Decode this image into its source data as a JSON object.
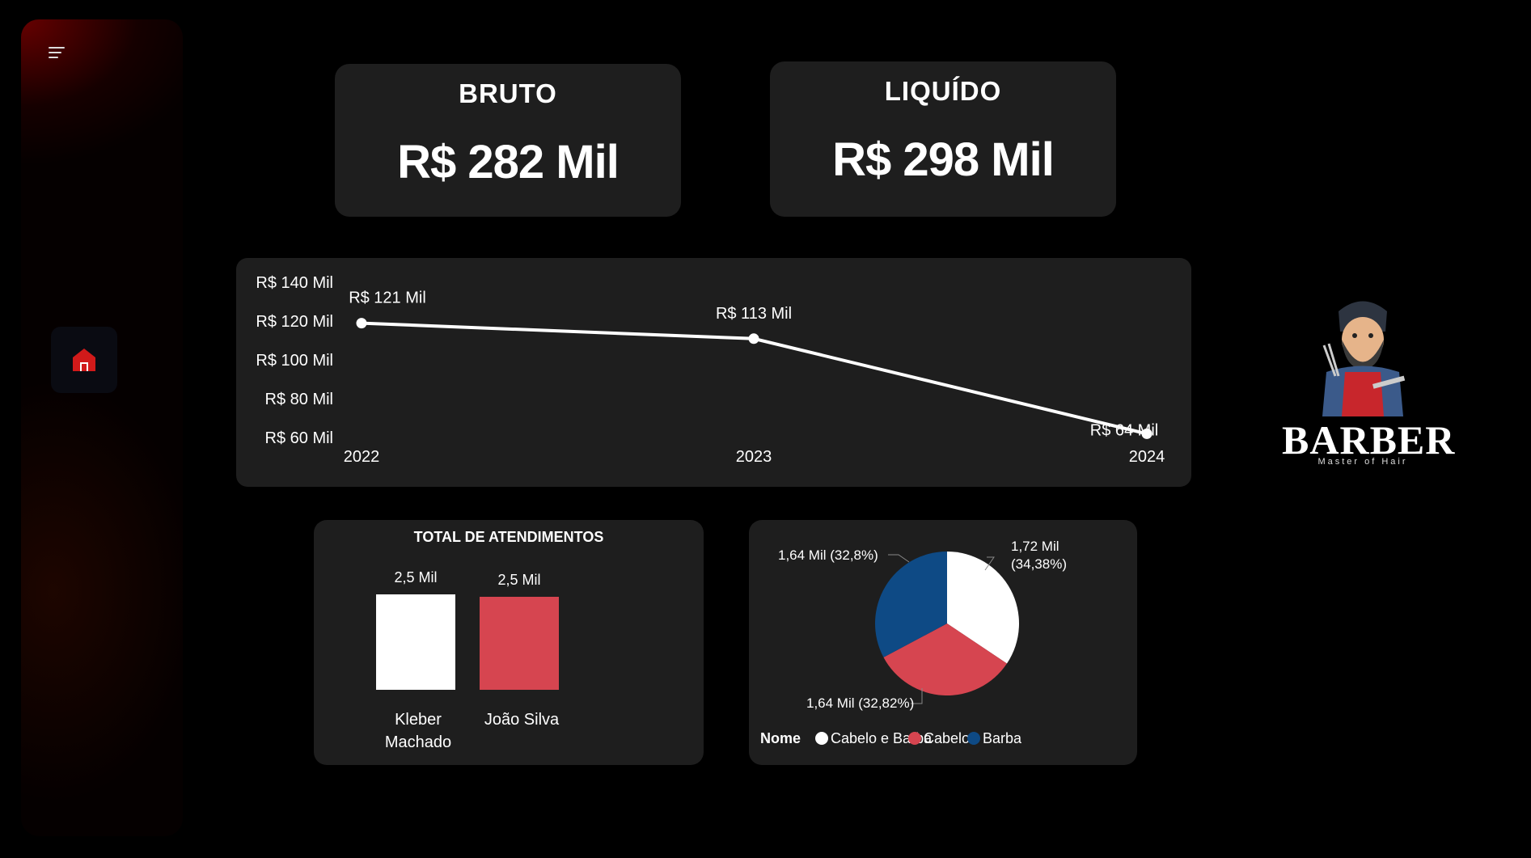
{
  "kpis": {
    "bruto": {
      "title": "BRUTO",
      "value": "R$ 282 Mil"
    },
    "liquido": {
      "title": "LIQUÍDO",
      "value": "R$ 298 Mil"
    }
  },
  "line_chart": {
    "type": "line",
    "x": [
      "2022",
      "2023",
      "2024"
    ],
    "values": [
      121,
      113,
      64
    ],
    "data_labels": [
      "R$ 121 Mil",
      "R$ 113 Mil",
      "R$ 64 Mil"
    ],
    "y_ticks": [
      "R$ 140 Mil",
      "R$ 120 Mil",
      "R$ 100 Mil",
      "R$ 80 Mil",
      "R$ 60 Mil"
    ],
    "ylim": [
      60,
      140
    ],
    "line_color": "#ffffff"
  },
  "chart_data": [
    {
      "type": "line",
      "x": [
        "2022",
        "2023",
        "2024"
      ],
      "values": [
        121,
        113,
        64
      ],
      "ylim": [
        60,
        140
      ]
    },
    {
      "type": "bar",
      "title": "TOTAL DE ATENDIMENTOS",
      "categories": [
        "Kleber Machado",
        "João Silva"
      ],
      "values": [
        2.5,
        2.5
      ],
      "data_labels": [
        "2,5 Mil",
        "2,5 Mil"
      ],
      "colors": [
        "#ffffff",
        "#d64550"
      ]
    },
    {
      "type": "pie",
      "legend_title": "Nome",
      "categories": [
        "Cabelo e Barba",
        "Cabelo",
        "Barba"
      ],
      "values": [
        34.38,
        32.82,
        32.8
      ],
      "colors": [
        "#ffffff",
        "#d64550",
        "#0e4a85"
      ]
    }
  ],
  "bar_chart": {
    "title": "TOTAL DE ATENDIMENTOS",
    "bars": [
      {
        "label_line1": "Kleber",
        "label_line2": "Machado",
        "value_label": "2,5 Mil",
        "color": "#ffffff"
      },
      {
        "label_line1": "João Silva",
        "label_line2": "",
        "value_label": "2,5 Mil",
        "color": "#d64550"
      }
    ]
  },
  "pie_chart": {
    "legend_title": "Nome",
    "legend": [
      "Cabelo e Barba",
      "Cabelo",
      "Barba"
    ],
    "labels": {
      "cabelo_barba_l1": "1,72 Mil",
      "cabelo_barba_l2": "(34,38%)",
      "cabelo": "1,64 Mil (32,82%)",
      "barba": "1,64 Mil (32,8%)"
    }
  },
  "brand": {
    "name": "BARBER",
    "tagline": "Master of Hair"
  },
  "icons": {
    "menu": "hamburger-icon",
    "home": "home-icon"
  },
  "colors": {
    "accent_red": "#d64550",
    "home_red": "#d11a1a",
    "navy": "#0e4a85",
    "card_bg": "#1e1e1e"
  }
}
